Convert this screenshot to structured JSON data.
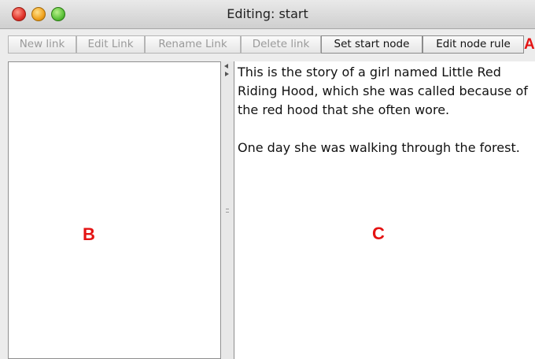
{
  "window": {
    "title": "Editing: start"
  },
  "toolbar": {
    "buttons": [
      {
        "label": "New link",
        "enabled": false
      },
      {
        "label": "Edit Link",
        "enabled": false
      },
      {
        "label": "Rename Link",
        "enabled": false
      },
      {
        "label": "Delete link",
        "enabled": false
      },
      {
        "label": "Set start node",
        "enabled": true
      },
      {
        "label": "Edit node rule",
        "enabled": true
      }
    ]
  },
  "annotations": {
    "a": "A",
    "b": "B",
    "c": "C",
    "color": "#e41313"
  },
  "editor": {
    "paragraphs": [
      "This is the story of a girl named Little Red Riding Hood, which she was called because of the red hood that she often wore.",
      "One day she was walking through the forest."
    ]
  }
}
